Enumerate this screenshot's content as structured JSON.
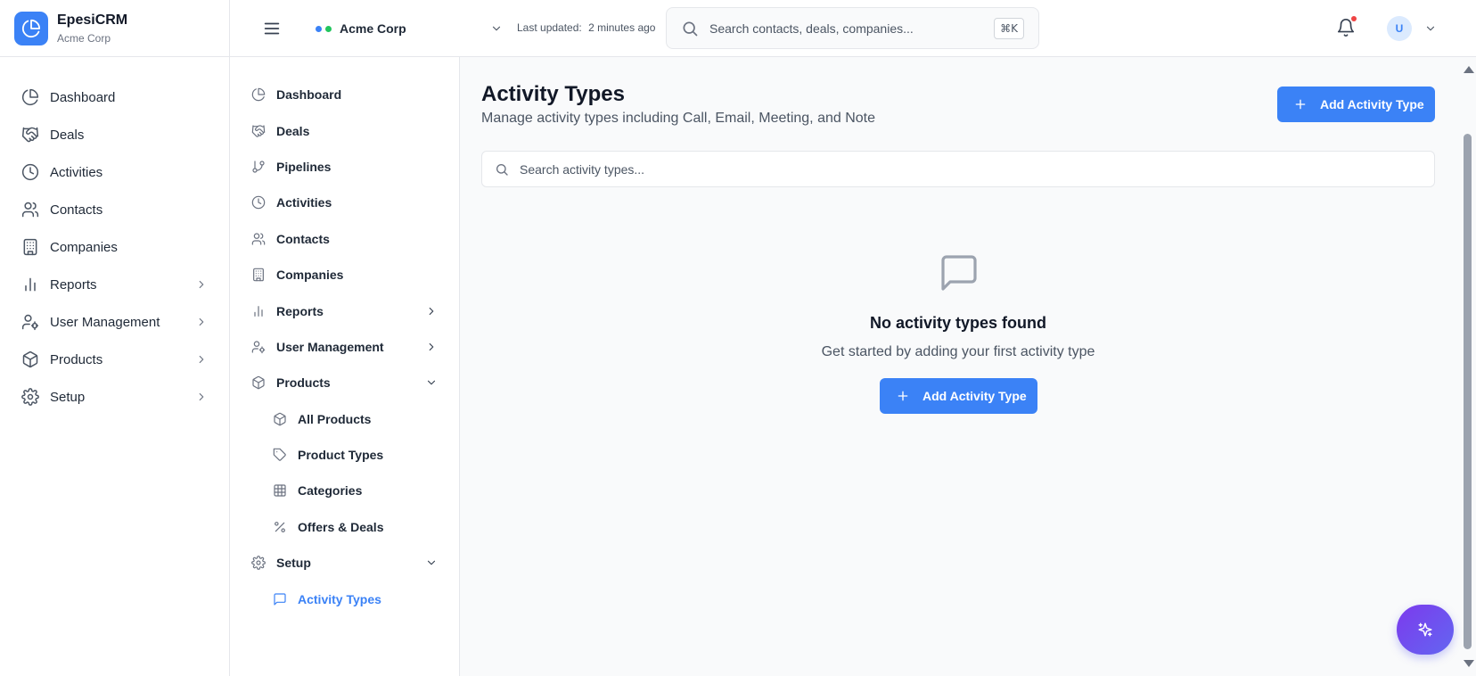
{
  "brand": {
    "name": "EpesiCRM",
    "org": "Acme Corp"
  },
  "primary_nav": [
    {
      "label": "Dashboard",
      "icon": "pie-chart-icon",
      "has_chevron": false
    },
    {
      "label": "Deals",
      "icon": "handshake-icon",
      "has_chevron": false
    },
    {
      "label": "Activities",
      "icon": "clock-icon",
      "has_chevron": false
    },
    {
      "label": "Contacts",
      "icon": "users-icon",
      "has_chevron": false
    },
    {
      "label": "Companies",
      "icon": "building-icon",
      "has_chevron": false
    },
    {
      "label": "Reports",
      "icon": "bar-chart-icon",
      "has_chevron": true
    },
    {
      "label": "User Management",
      "icon": "user-cog-icon",
      "has_chevron": true
    },
    {
      "label": "Products",
      "icon": "package-icon",
      "has_chevron": true
    },
    {
      "label": "Setup",
      "icon": "gear-icon",
      "has_chevron": true
    }
  ],
  "header": {
    "org_switcher": "Acme Corp",
    "last_updated_label": "Last updated:",
    "last_updated_value": "2 minutes ago",
    "search_placeholder": "Search contacts, deals, companies...",
    "shortcut": "⌘K",
    "avatar_initial": "U",
    "org_dot_colors": [
      "#3b82f6",
      "#22c55e"
    ],
    "notification_dot_color": "#ef4444"
  },
  "secondary_nav": {
    "items": [
      {
        "label": "Dashboard",
        "icon": "pie-chart-icon"
      },
      {
        "label": "Deals",
        "icon": "handshake-icon"
      },
      {
        "label": "Pipelines",
        "icon": "git-branch-icon"
      },
      {
        "label": "Activities",
        "icon": "clock-icon"
      },
      {
        "label": "Contacts",
        "icon": "users-icon"
      },
      {
        "label": "Companies",
        "icon": "building-icon"
      },
      {
        "label": "Reports",
        "icon": "bar-chart-icon",
        "chevron": "right"
      },
      {
        "label": "User Management",
        "icon": "user-cog-icon",
        "chevron": "right"
      },
      {
        "label": "Products",
        "icon": "package-icon",
        "chevron": "down"
      }
    ],
    "products_children": [
      {
        "label": "All Products",
        "icon": "package-icon"
      },
      {
        "label": "Product Types",
        "icon": "tag-icon"
      },
      {
        "label": "Categories",
        "icon": "grid-icon"
      },
      {
        "label": "Offers & Deals",
        "icon": "percent-icon"
      }
    ],
    "setup": {
      "label": "Setup",
      "icon": "gear-icon",
      "chevron": "down"
    },
    "setup_children": [
      {
        "label": "Activity Types",
        "icon": "message-square-icon",
        "active": true
      }
    ]
  },
  "main": {
    "title": "Activity Types",
    "subtitle": "Manage activity types including Call, Email, Meeting, and Note",
    "add_button": "Add Activity Type",
    "search_placeholder": "Search activity types...",
    "empty_title": "No activity types found",
    "empty_subtitle": "Get started by adding your first activity type",
    "empty_button": "Add Activity Type"
  },
  "colors": {
    "accent": "#3b82f6",
    "fab_gradient": [
      "#7c3aed",
      "#6366f1"
    ]
  }
}
